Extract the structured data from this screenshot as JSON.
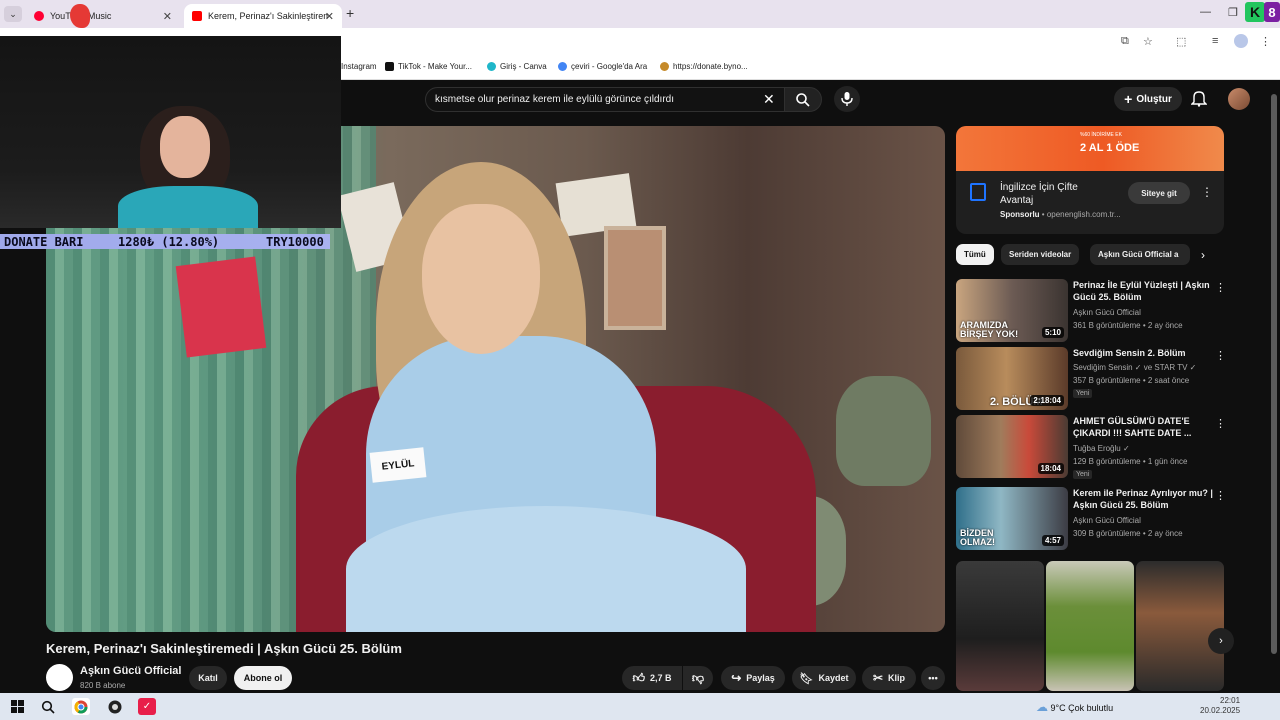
{
  "browser": {
    "tabs": [
      {
        "label": "YouTube Music",
        "active": false
      },
      {
        "label": "Kerem, Perinaz'ı Sakinleştiremedi",
        "active": true
      }
    ],
    "bookmarks": [
      {
        "label": "Instagram"
      },
      {
        "label": "TikTok - Make Your..."
      },
      {
        "label": "Giriş - Canva"
      },
      {
        "label": "çeviri - Google'da Ara"
      },
      {
        "label": "https://donate.byno..."
      }
    ],
    "extension_badge": {
      "letter": "K",
      "number": "8"
    }
  },
  "overlay": {
    "donate_label": "DONATE BARI",
    "donate_amount": "1280₺ (12.80%)",
    "donate_goal": "TRY10000",
    "donate_progress": 0.128
  },
  "youtube": {
    "search": {
      "query": "kısmetse olur perinaz kerem ile eylülü görünce çıldırdı"
    },
    "header": {
      "create_label": "Oluştur"
    },
    "video": {
      "title": "Kerem, Perinaz'ı Sakinleştiremedi | Aşkın Gücü 25. Bölüm",
      "name_tag": "EYLÜL",
      "channel": "Aşkın Gücü Official",
      "subscribers": "820 B abone",
      "join_label": "Katıl",
      "subscribe_label": "Abone ol",
      "likes": "2,7 B",
      "share_label": "Paylaş",
      "save_label": "Kaydet",
      "clip_label": "Klip"
    },
    "ad": {
      "banner_headline": "2 AL 1 ÖDE",
      "banner_sub": "%60 İNDİRİME EK",
      "title": "İngilizce İçin Çifte Avantaj",
      "sponsor_label": "Sponsorlu",
      "domain": "openenglish.com.tr...",
      "cta": "Siteye git"
    },
    "chips": [
      {
        "label": "Tümü",
        "active": true
      },
      {
        "label": "Seriden videolar",
        "active": false
      },
      {
        "label": "Aşkın Gücü Official a",
        "active": false
      }
    ],
    "recommendations": [
      {
        "title": "Perinaz İle Eylül Yüzleşti | Aşkın Gücü 25. Bölüm",
        "channel": "Aşkın Gücü Official",
        "meta": "361 B görüntüleme • 2 ay önce",
        "duration": "5:10",
        "overlay": "ARAMIZDA BİRŞEY YOK!",
        "badge": ""
      },
      {
        "title": "Sevdiğim Sensin 2. Bölüm",
        "channel": "Sevdiğim Sensin ✓ ve STAR TV ✓",
        "meta": "357 B görüntüleme • 2 saat önce",
        "duration": "2:18:04",
        "overlay": "2. BÖLÜM",
        "badge": "Yeni"
      },
      {
        "title": "AHMET GÜLSÜM'Ü DATE'E ÇIKARDI !!! SAHTE DATE ...",
        "channel": "Tuğba Eroğlu ✓",
        "meta": "129 B görüntüleme • 1 gün önce",
        "duration": "18:04",
        "overlay": "",
        "badge": "Yeni"
      },
      {
        "title": "Kerem ile Perinaz Ayrılıyor mu? | Aşkın Gücü 25. Bölüm",
        "channel": "Aşkın Gücü Official",
        "meta": "309 B görüntüleme • 2 ay önce",
        "duration": "4:57",
        "overlay": "BİZDEN OLMAZ!",
        "badge": ""
      }
    ]
  },
  "taskbar": {
    "weather": "9°C  Çok bulutlu",
    "time": "22:01",
    "date": "20.02.2025"
  }
}
